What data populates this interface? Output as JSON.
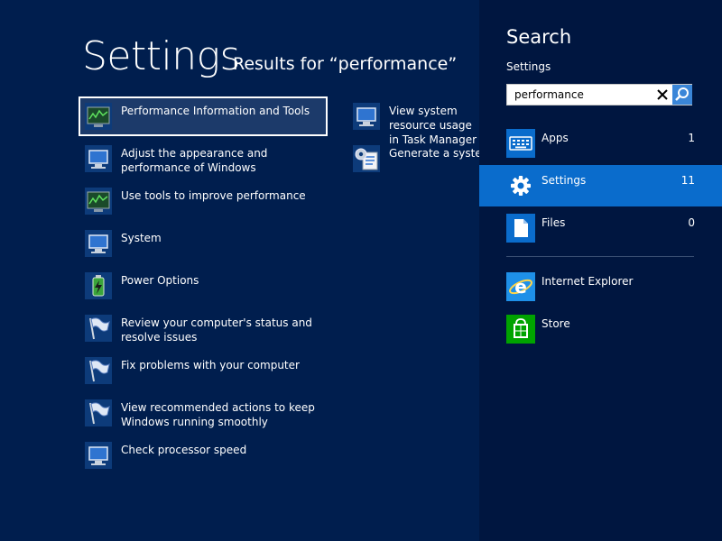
{
  "header": {
    "title": "Settings",
    "subtitle": "Results for “performance”"
  },
  "results": [
    {
      "label": "Performance Information and Tools",
      "icon": "performance-monitor-icon",
      "selected": true
    },
    {
      "label": "Adjust the appearance and performance of Windows",
      "icon": "computer-icon"
    },
    {
      "label": "Use tools to improve performance",
      "icon": "performance-monitor-icon"
    },
    {
      "label": "System",
      "icon": "computer-icon"
    },
    {
      "label": "Power Options",
      "icon": "battery-icon"
    },
    {
      "label": "Review your computer's status and resolve issues",
      "icon": "action-center-flag-icon"
    },
    {
      "label": "Fix problems with your computer",
      "icon": "action-center-flag-icon"
    },
    {
      "label": "View recommended actions to keep Windows running smoothly",
      "icon": "action-center-flag-icon"
    },
    {
      "label": "Check processor speed",
      "icon": "computer-icon"
    },
    {
      "label": "View system resource usage in Task Manager",
      "icon": "computer-icon"
    },
    {
      "label": "Generate a system health report",
      "icon": "system-health-report-icon"
    }
  ],
  "charm": {
    "title": "Search",
    "scope": "Settings",
    "search": {
      "value": "performance",
      "placeholder": ""
    },
    "categories": [
      {
        "label": "Apps",
        "count": "1",
        "icon": "apps-keyboard-icon"
      },
      {
        "label": "Settings",
        "count": "11",
        "icon": "gear-icon",
        "active": true
      },
      {
        "label": "Files",
        "count": "0",
        "icon": "file-icon"
      }
    ],
    "apps": [
      {
        "label": "Internet Explorer",
        "icon": "internet-explorer-icon"
      },
      {
        "label": "Store",
        "icon": "store-icon"
      }
    ]
  },
  "colors": {
    "background": "#001e4e",
    "charm_background": "#001640",
    "active_category": "#0a6ccc",
    "search_button": "#3a86d8",
    "store_tile": "#00a300",
    "ie_blue": "#1e90e8"
  }
}
